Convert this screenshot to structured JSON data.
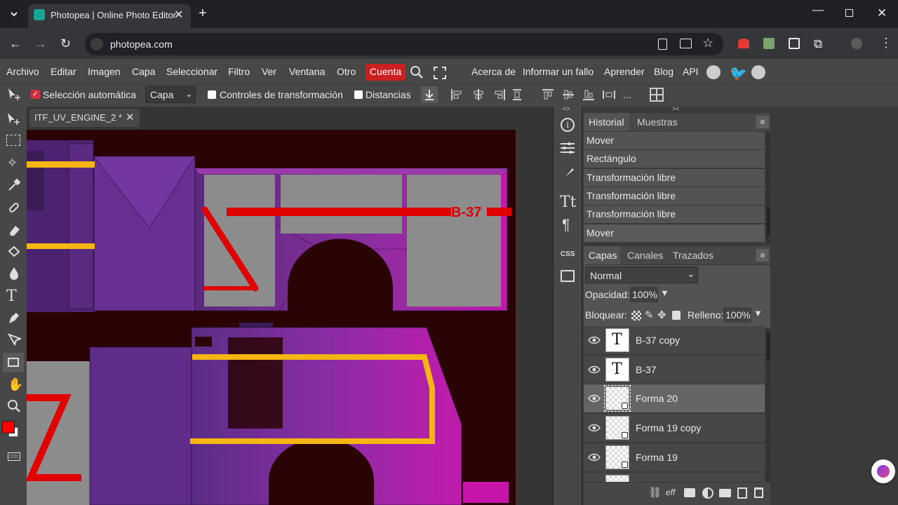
{
  "browser": {
    "tab_title": "Photopea | Online Photo Editor",
    "url": "photopea.com"
  },
  "menu": {
    "items": [
      "Archivo",
      "Editar",
      "Imagen",
      "Capa",
      "Seleccionar",
      "Filtro",
      "Ver",
      "Ventana",
      "Otro"
    ],
    "account": "Cuenta",
    "right_items": [
      "Acerca de",
      "Informar un fallo",
      "Aprender",
      "Blog",
      "API"
    ]
  },
  "tool_options": {
    "auto_select_label": "Selección automática",
    "auto_select_checked": true,
    "target_value": "Capa",
    "transform_controls_label": "Controles de transformación",
    "distances_label": "Distancias",
    "more": "..."
  },
  "document": {
    "tab_name": "ITF_UV_ENGINE_2 *"
  },
  "canvas": {
    "text_label": "B-37"
  },
  "history_panel": {
    "tabs": [
      "Historial",
      "Muestras"
    ],
    "items": [
      "Mover",
      "Rectángulo",
      "Transformación libre",
      "Transformación libre",
      "Transformación libre",
      "Mover"
    ]
  },
  "layers_panel": {
    "tabs": [
      "Capas",
      "Canales",
      "Trazados"
    ],
    "blend_mode": "Normal",
    "opacity_label": "Opacidad:",
    "opacity_value": "100%",
    "lock_label": "Bloquear:",
    "fill_label": "Relleno:",
    "fill_value": "100%",
    "layers": [
      {
        "name": "B-37 copy",
        "type": "text",
        "selected": false
      },
      {
        "name": "B-37",
        "type": "text",
        "selected": false
      },
      {
        "name": "Forma 20",
        "type": "shape",
        "selected": true
      },
      {
        "name": "Forma 19 copy",
        "type": "shape",
        "selected": false
      },
      {
        "name": "Forma 19",
        "type": "shape",
        "selected": false
      }
    ]
  },
  "sidebar_mid": {
    "css_label": "CSS",
    "collapse_left": "<>",
    "collapse_right": "><"
  },
  "colors": {
    "foreground": "#ff0000",
    "background": "#ffffff",
    "accent_account": "#cc1f1f"
  }
}
